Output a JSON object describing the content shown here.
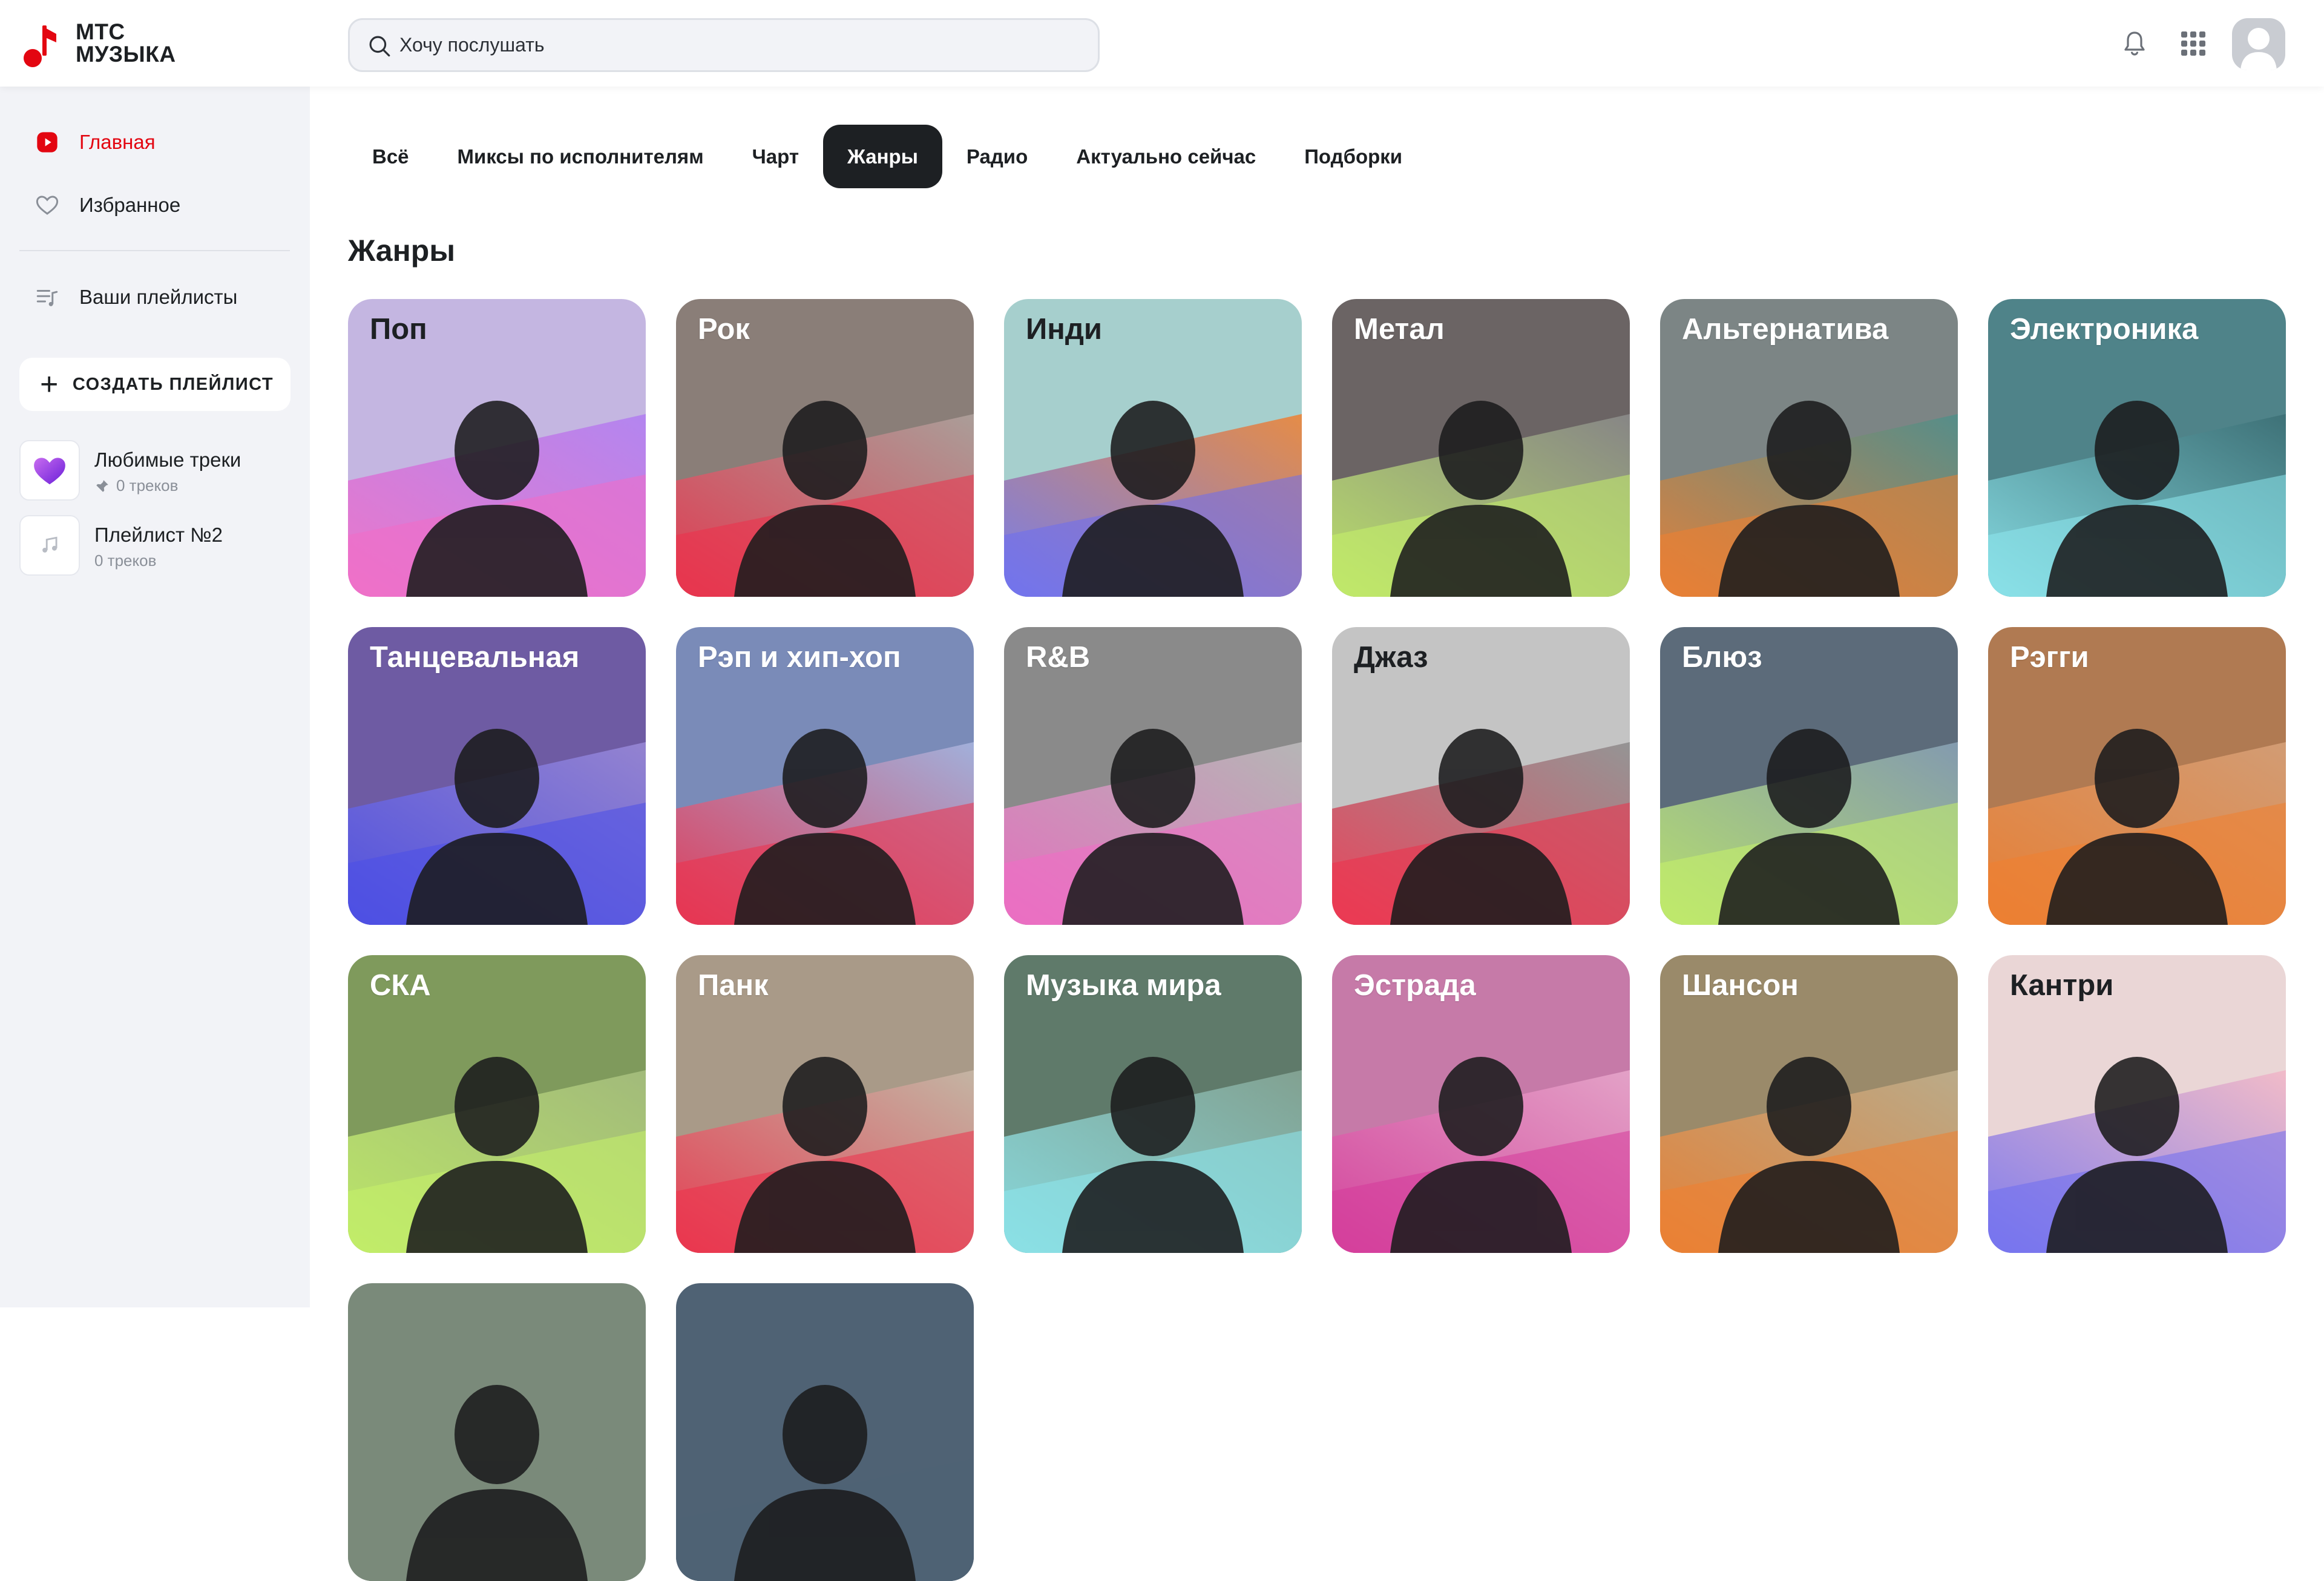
{
  "app": {
    "logo_line1": "МТС",
    "logo_line2": "МУЗЫКА"
  },
  "search": {
    "placeholder": "Хочу послушать"
  },
  "header_icons": [
    "bell-icon",
    "apps-grid-icon",
    "avatar"
  ],
  "sidebar": {
    "nav": [
      {
        "label": "Главная",
        "icon": "home-play-icon",
        "active": true
      },
      {
        "label": "Избранное",
        "icon": "heart-icon",
        "active": false
      },
      {
        "label": "Ваши плейлисты",
        "icon": "playlist-icon",
        "active": false
      }
    ],
    "create_playlist_label": "СОЗДАТЬ ПЛЕЙЛИСТ",
    "playlists": [
      {
        "title": "Любимые треки",
        "subtitle": "0 треков",
        "icon": "heart-cover-icon",
        "pinned": true
      },
      {
        "title": "Плейлист №2",
        "subtitle": "0 треков",
        "icon": "music-note-icon",
        "pinned": false
      }
    ]
  },
  "tabs": [
    {
      "label": "Всё",
      "active": false
    },
    {
      "label": "Миксы по исполнителям",
      "active": false
    },
    {
      "label": "Чарт",
      "active": false
    },
    {
      "label": "Жанры",
      "active": true
    },
    {
      "label": "Радио",
      "active": false
    },
    {
      "label": "Актуально сейчас",
      "active": false
    },
    {
      "label": "Подборки",
      "active": false
    }
  ],
  "section_title": "Жанры",
  "genres": [
    {
      "label": "Поп",
      "bg": "#c4b6e1",
      "accent1": "#f26cc6",
      "accent2": "#b07df2",
      "dark": true
    },
    {
      "label": "Рок",
      "bg": "#8a7e78",
      "accent1": "#ef2f4a",
      "accent2": "#b0a39e",
      "dark": false
    },
    {
      "label": "Инди",
      "bg": "#a6cfcd",
      "accent1": "#6e6ef0",
      "accent2": "#f08030",
      "dark": true
    },
    {
      "label": "Метал",
      "bg": "#6b6464",
      "accent1": "#c6f36a",
      "accent2": "#8c8c8c",
      "dark": false
    },
    {
      "label": "Альтернатива",
      "bg": "#7c8585",
      "accent1": "#f08030",
      "accent2": "#4f8f8a",
      "dark": false
    },
    {
      "label": "Электроника",
      "bg": "#4f8389",
      "accent1": "#8ee8ef",
      "accent2": "#3b6e74",
      "dark": false
    },
    {
      "label": "Танцевальная",
      "bg": "#6e5ba3",
      "accent1": "#4a4fe8",
      "accent2": "#9a8ad8",
      "dark": false
    },
    {
      "label": "Рэп и хип-хоп",
      "bg": "#7a8bb8",
      "accent1": "#ef2f4a",
      "accent2": "#a8b6e0",
      "dark": false
    },
    {
      "label": "R&B",
      "bg": "#8a8a8a",
      "accent1": "#f26cc6",
      "accent2": "#bdbdbd",
      "dark": false
    },
    {
      "label": "Джаз",
      "bg": "#c4c4c4",
      "accent1": "#ef2f4a",
      "accent2": "#8c8c8c",
      "dark": true
    },
    {
      "label": "Блюз",
      "bg": "#5c6b7a",
      "accent1": "#c6f36a",
      "accent2": "#8aa3b8",
      "dark": false
    },
    {
      "label": "Рэгги",
      "bg": "#b07a52",
      "accent1": "#f08030",
      "accent2": "#d8a27a",
      "dark": false
    },
    {
      "label": "СКА",
      "bg": "#7f9a5c",
      "accent1": "#c6f36a",
      "accent2": "#a8c080",
      "dark": false
    },
    {
      "label": "Панк",
      "bg": "#a99a88",
      "accent1": "#ef2f4a",
      "accent2": "#c8b9a8",
      "dark": false
    },
    {
      "label": "Музыка мира",
      "bg": "#5f7a6a",
      "accent1": "#8ee8ef",
      "accent2": "#88a898",
      "dark": false
    },
    {
      "label": "Эстрада",
      "bg": "#c67aa8",
      "accent1": "#d63a9a",
      "accent2": "#e8a8cc",
      "dark": false
    },
    {
      "label": "Шансон",
      "bg": "#9a8a6a",
      "accent1": "#f08030",
      "accent2": "#c0b08e",
      "dark": false
    },
    {
      "label": "Кантри",
      "bg": "#ead6d6",
      "accent1": "#6e6ef0",
      "accent2": "#f2b6c6",
      "dark": true
    },
    {
      "label": "",
      "bg": "#7a8a7a",
      "accent1": "#7a8a7a",
      "accent2": "#7a8a7a",
      "dark": false
    },
    {
      "label": "",
      "bg": "#4f6274",
      "accent1": "#4f6274",
      "accent2": "#4f6274",
      "dark": false
    }
  ]
}
